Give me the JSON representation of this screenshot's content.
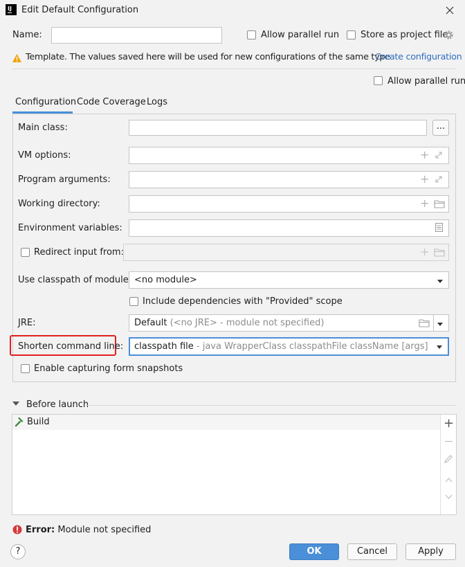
{
  "window": {
    "title": "Edit Default Configuration",
    "app_badge": "IJ"
  },
  "header": {
    "name_label": "Name:",
    "name_value": "",
    "allow_parallel_label": "Allow parallel run",
    "store_project_label": "Store as project file",
    "template_warning": "Template. The values saved here will be used for new configurations of the same type",
    "create_config_link": "Create configuration"
  },
  "allow_parallel_second_label": "Allow parallel run",
  "tabs": [
    {
      "label": "Configuration",
      "active": true
    },
    {
      "label": "Code Coverage",
      "active": false
    },
    {
      "label": "Logs",
      "active": false
    }
  ],
  "form": {
    "main_class_label": "Main class:",
    "main_class_value": "",
    "browse_button": "...",
    "vm_options_label": "VM options:",
    "program_arguments_label": "Program arguments:",
    "working_directory_label": "Working directory:",
    "environment_variables_label": "Environment variables:",
    "redirect_input_label": "Redirect input from:",
    "classpath_module_label": "Use classpath of module:",
    "classpath_module_value": "<no module>",
    "include_dependencies_label": "Include dependencies with \"Provided\" scope",
    "jre_label": "JRE:",
    "jre_value_main": "Default",
    "jre_value_hint": "(<no JRE> - module not specified)",
    "shorten_label": "Shorten command line:",
    "shorten_value_main": "classpath file",
    "shorten_value_hint": "- java WrapperClass classpathFile className [args]",
    "capture_snapshots_label": "Enable capturing form snapshots"
  },
  "before_launch": {
    "title": "Before launch",
    "items": [
      {
        "label": "Build",
        "icon": "hammer-icon"
      }
    ]
  },
  "error": {
    "prefix": "Error:",
    "message": "Module not specified"
  },
  "footer": {
    "help": "?",
    "ok": "OK",
    "cancel": "Cancel",
    "apply": "Apply"
  },
  "colors": {
    "accent": "#4a8fd8",
    "link": "#2f6fc4",
    "highlight_red": "#e0201e",
    "error_red": "#d63a3a",
    "warning": "#f0a30a"
  }
}
